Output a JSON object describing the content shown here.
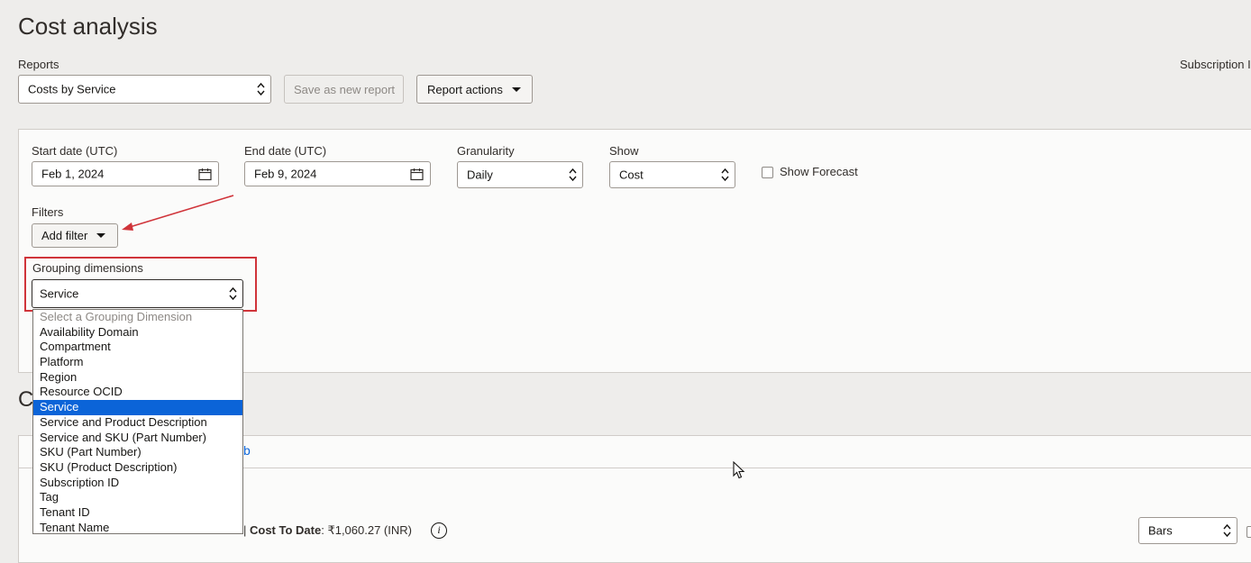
{
  "page": {
    "title": "Cost analysis"
  },
  "reports": {
    "label": "Reports",
    "selected": "Costs by Service",
    "save_label": "Save as new report",
    "actions_label": "Report actions",
    "subscription_label": "Subscription I"
  },
  "params": {
    "start_date_label": "Start date (UTC)",
    "start_date_value": "Feb 1, 2024",
    "end_date_label": "End date (UTC)",
    "end_date_value": "Feb 9, 2024",
    "granularity_label": "Granularity",
    "granularity_value": "Daily",
    "show_label": "Show",
    "show_value": "Cost",
    "forecast_label": "Show Forecast",
    "filters_label": "Filters",
    "add_filter_label": "Add filter",
    "grouping_label": "Grouping dimensions",
    "grouping_value": "Service"
  },
  "grouping_options": [
    "Select a Grouping Dimension",
    "Availability Domain",
    "Compartment",
    "Platform",
    "Region",
    "Resource OCID",
    "Service",
    "Service and Product Description",
    "Service and SKU (Part Number)",
    "SKU (Part Number)",
    "SKU (Product Description)",
    "Subscription ID",
    "Tag",
    "Tenant ID",
    "Tenant Name"
  ],
  "results": {
    "section_initial": "C",
    "tab_fragment": "b",
    "cost_to_date_label": "Cost To Date",
    "cost_to_date_value": ": ₹1,060.27 (INR)",
    "chart_type": "Bars"
  },
  "colors": {
    "accent": "#0b64d8",
    "highlight": "#d0343a"
  }
}
